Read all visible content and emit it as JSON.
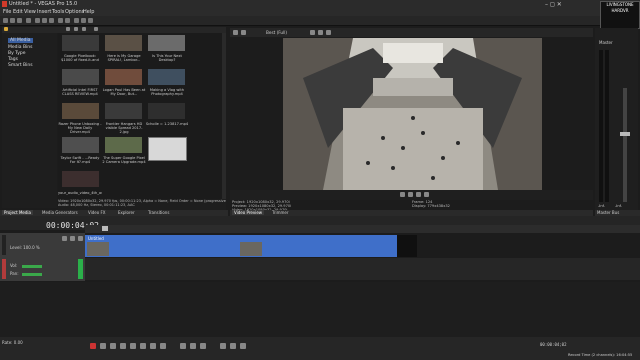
{
  "window": {
    "title": "Untitled * - VEGAS Pro 15.0",
    "controls": "– ◻ ✕"
  },
  "logo_text": "LIVINGSTONE HARDVR",
  "menu": [
    "File",
    "Edit",
    "View",
    "Insert",
    "Tools",
    "Options",
    "Help"
  ],
  "explorer": {
    "tree": [
      "All Media",
      "Media Bins",
      "By Type",
      "Tags",
      "Smart Bins"
    ],
    "captions": [
      "Google Pixelbook: $1000 of fixed-it-and",
      "Here is My Garage SPIRAL!, Lambor...",
      "Is This Your Next Desktop?",
      "Artificial Intel FIRST CLASS REVIEW.mp4",
      "Logan Paul Has Been at My Door, But...",
      "Making a Vlog with Photography.mp4",
      "Razer Phone Unboxing - My New Daily Driver.mp4",
      "Frontier Hangars HD visible Spread 2017-2.jpg",
      "Scholle = 1.23817.mp4",
      "Taylor Swift - ...Ready For It?.mp4",
      "The Super Google Pixel 2 Camera Upgrade.mp4",
      "",
      "your_audio_video_4th_out"
    ],
    "info_line1": "Video: 1920x1080x32, 29.970 fps, 00:00:11:23, Alpha = None, Field Order = None (progressive scan)",
    "info_line2": "Audio: 48,000 Hz, Stereo, 00:01:11:23, AAC"
  },
  "left_tabs": [
    "Project Media",
    "Media Generators",
    "Video FX",
    "Explorer",
    "Transitions"
  ],
  "preview": {
    "quality": "Best (Full)",
    "project_label": "Project:",
    "project_value": "1920x1080x32, 29.970i",
    "preview_label": "Preview:",
    "preview_value": "1920x1080x32, 29.970i",
    "video_label": "Video:",
    "video_value": "1920x1080x32, 29.970i",
    "frame_label": "Frame:",
    "frame_value": "124",
    "display_label": "Display:",
    "display_value": "779x438x32",
    "tabs": [
      "Video Preview",
      "Trimmer"
    ]
  },
  "master": {
    "label": "Master",
    "bus_label": "Master Bus",
    "level_left": "-Inf.",
    "level_right": "-Inf."
  },
  "timeline": {
    "timecode": "00:00:04;02",
    "track1_level": "Level: 100.0 %",
    "track2_vol": "Vol:",
    "track2_pan": "Pan:",
    "clip_label": "Untitled",
    "rate_label": "Rate: 0.00",
    "end_time": "00:00:04;02",
    "record_time": "Record Time (2 channels): 16:04:55"
  }
}
